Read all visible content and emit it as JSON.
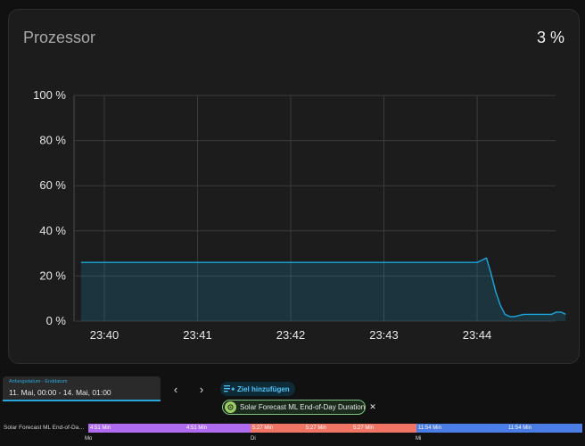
{
  "card": {
    "title": "Prozessor",
    "current_value": "3 %"
  },
  "chart_data": {
    "type": "area",
    "title": "Prozessor",
    "y_ticks": [
      "100 %",
      "80 %",
      "60 %",
      "40 %",
      "20 %",
      "0 %"
    ],
    "x_ticks": [
      "23:40",
      "23:41",
      "23:42",
      "23:43",
      "23:44"
    ],
    "ylim": [
      0,
      100
    ],
    "grid": true,
    "series": [
      {
        "color": "#1aa7dc",
        "points": [
          [
            "23:39:45",
            26
          ],
          [
            "23:40:00",
            26
          ],
          [
            "23:41:00",
            26
          ],
          [
            "23:42:00",
            26
          ],
          [
            "23:43:00",
            26
          ],
          [
            "23:44:00",
            26
          ],
          [
            "23:44:03",
            27
          ],
          [
            "23:44:06",
            28
          ],
          [
            "23:44:09",
            21
          ],
          [
            "23:44:12",
            13
          ],
          [
            "23:44:15",
            7
          ],
          [
            "23:44:18",
            3
          ],
          [
            "23:44:21",
            2
          ],
          [
            "23:44:24",
            2
          ],
          [
            "23:44:27",
            2.5
          ],
          [
            "23:44:30",
            3
          ],
          [
            "23:44:36",
            3
          ],
          [
            "23:44:42",
            3
          ],
          [
            "23:44:48",
            3
          ],
          [
            "23:44:51",
            4
          ],
          [
            "23:44:54",
            4
          ],
          [
            "23:44:57",
            3
          ]
        ]
      }
    ]
  },
  "date_picker": {
    "label": "Anfangsdatum - Enddatum",
    "value": "11. Mai, 00:00 - 14. Mai, 01:00"
  },
  "nav": {
    "prev": "‹",
    "next": "›"
  },
  "add_target": {
    "label": "Ziel hinzufügen"
  },
  "chip": {
    "label": "Solar Forecast ML End-of-Day Duration",
    "close": "✕"
  },
  "timeline": {
    "label": "Solar Forecast ML End-of-Day D...",
    "segments": [
      {
        "color": "#b06cf0",
        "texts": [
          "4:51 Min",
          "4:51 Min"
        ]
      },
      {
        "color": "#f07565",
        "texts": [
          "5:27 Min",
          "5:27 Min",
          "5:27 Min"
        ]
      },
      {
        "color": "#4a7ee6",
        "texts": [
          "11:54 Min",
          "11:54 Min"
        ]
      }
    ],
    "days": [
      "Mo",
      "Di",
      "Mi"
    ]
  }
}
